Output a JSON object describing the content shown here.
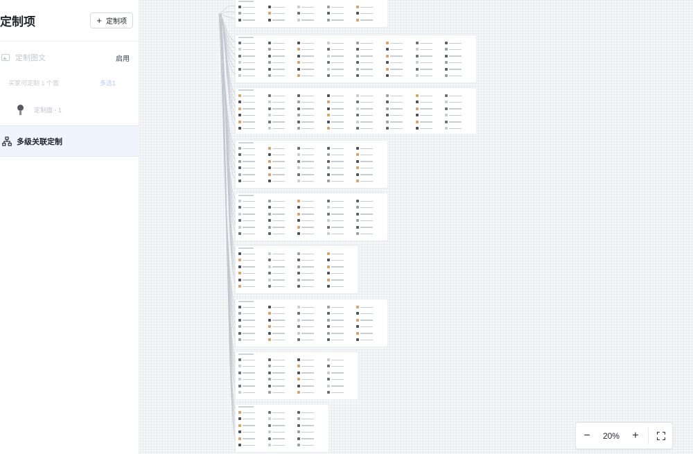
{
  "sidebar": {
    "title": "定制项",
    "add_button_label": "定制项",
    "image_text_row": {
      "label": "定制图文",
      "status": "启用"
    },
    "hint_row": {
      "text": "买家可定制 1 个面",
      "multi_select": "多选1"
    },
    "sub_item": {
      "label": "定制面 - 1"
    },
    "tree_row": {
      "label": "多级关联定制"
    }
  },
  "zoom": {
    "minus": "−",
    "value": "20%",
    "plus": "+"
  },
  "icons": {
    "add": "plus-icon",
    "image": "image-icon",
    "thumb": "product-thumbnail-icon",
    "tree": "hierarchy-tree-icon",
    "fullscreen": "fullscreen-icon"
  },
  "colors": {
    "accent_bg": "#eff4fd",
    "link": "#b6cdf6",
    "grid": "#e9ebef"
  }
}
